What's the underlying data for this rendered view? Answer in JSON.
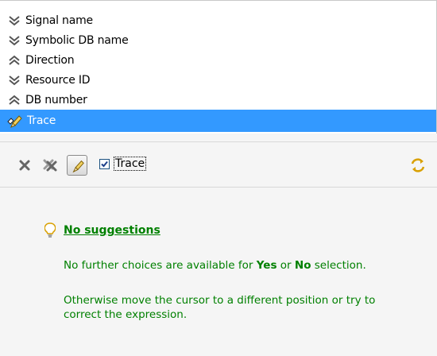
{
  "columns": [
    {
      "label": "Signal name",
      "sort": "down"
    },
    {
      "label": "Symbolic DB name",
      "sort": "down"
    },
    {
      "label": "Direction",
      "sort": "up"
    },
    {
      "label": "Resource ID",
      "sort": "down"
    },
    {
      "label": "DB number",
      "sort": "up"
    },
    {
      "label": "Trace",
      "selected": true
    }
  ],
  "toolbar": {
    "trace_checkbox_label": "Trace",
    "trace_checked": true
  },
  "suggestions": {
    "title": "No suggestions",
    "line1_pre": "No further choices are available for ",
    "line1_yes": "Yes",
    "line1_or": " or ",
    "line1_no": "No",
    "line1_post": " selection.",
    "line2": "Otherwise move the cursor to a different position or try to correct the expression."
  },
  "colors": {
    "selection": "#3399ff",
    "suggestion_text": "#008000"
  }
}
